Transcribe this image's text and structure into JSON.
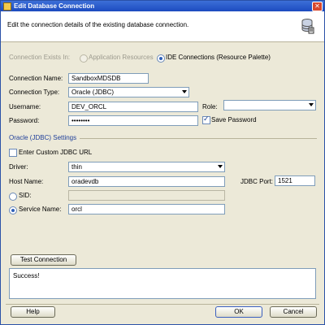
{
  "window": {
    "title": "Edit Database Connection",
    "close_glyph": "✕"
  },
  "header": {
    "description": "Edit the connection details of the existing database connection."
  },
  "exists_in": {
    "label": "Connection Exists In:",
    "options": [
      "Application Resources",
      "IDE Connections (Resource Palette)"
    ]
  },
  "connection_name": {
    "label": "Connection Name:",
    "value": "SandboxMDSDB"
  },
  "connection_type": {
    "label": "Connection Type:",
    "value": "Oracle (JDBC)"
  },
  "username": {
    "label": "Username:",
    "value": "DEV_ORCL"
  },
  "password": {
    "label": "Password:",
    "value": "••••••••"
  },
  "role": {
    "label": "Role:",
    "value": ""
  },
  "save_password": {
    "label": "Save Password",
    "checked": true
  },
  "section": {
    "title": "Oracle (JDBC) Settings"
  },
  "custom_url": {
    "label": "Enter Custom JDBC URL"
  },
  "driver": {
    "label": "Driver:",
    "value": "thin"
  },
  "host": {
    "label": "Host Name:",
    "value": "oradevdb"
  },
  "port": {
    "label": "JDBC Port:",
    "value": "1521"
  },
  "sid": {
    "label": "SID:",
    "value": ""
  },
  "service": {
    "label": "Service Name:",
    "value": "orcl"
  },
  "test_button": {
    "label": "Test Connection"
  },
  "status": {
    "text": "Success!"
  },
  "buttons": {
    "help": "Help",
    "ok": "OK",
    "cancel": "Cancel"
  }
}
